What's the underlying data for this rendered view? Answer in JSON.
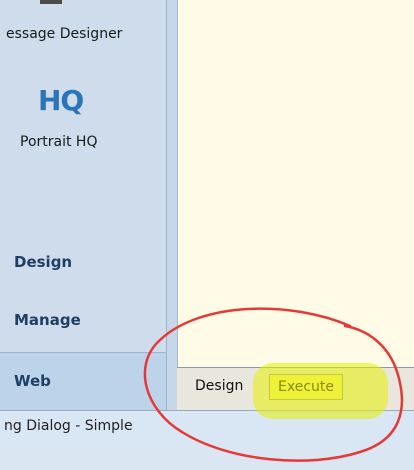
{
  "sidebar": {
    "top_item_label": "essage Designer",
    "hq": {
      "logo_text": "HQ",
      "label": "Portrait HQ"
    },
    "nav": {
      "design": "Design",
      "manage": "Manage",
      "web": "Web"
    }
  },
  "tabs": {
    "design": "Design",
    "execute": "Execute"
  },
  "status": {
    "text": "ng Dialog - Simple"
  },
  "colors": {
    "annotation": "#e53935",
    "highlight": "#e6f000",
    "canvas": "#fffbe6",
    "sidebar": "#cfdceb",
    "hq_blue": "#2a74b8"
  }
}
